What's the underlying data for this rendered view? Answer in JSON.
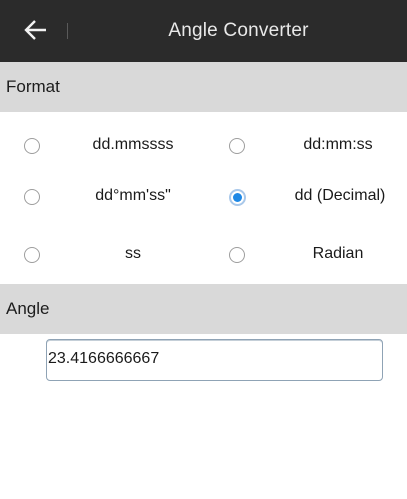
{
  "app": {
    "title": "Angle Converter"
  },
  "sections": {
    "format_label": "Format",
    "angle_label": "Angle"
  },
  "format_options": [
    {
      "label": "dd.mmssss",
      "checked": false
    },
    {
      "label": "dd:mm:ss",
      "checked": false
    },
    {
      "label": "dd°mm'ss\"",
      "checked": false
    },
    {
      "label": "dd (Decimal)",
      "checked": true
    },
    {
      "label": "ss",
      "checked": false
    },
    {
      "label": "Radian",
      "checked": false
    }
  ],
  "angle_input": {
    "value": "23.4166666667"
  },
  "colors": {
    "titlebar": "#2b2b2b",
    "section_header": "#d9d9d9",
    "accent": "#1e88e5"
  },
  "icons": {
    "back": "arrow-left-icon"
  }
}
